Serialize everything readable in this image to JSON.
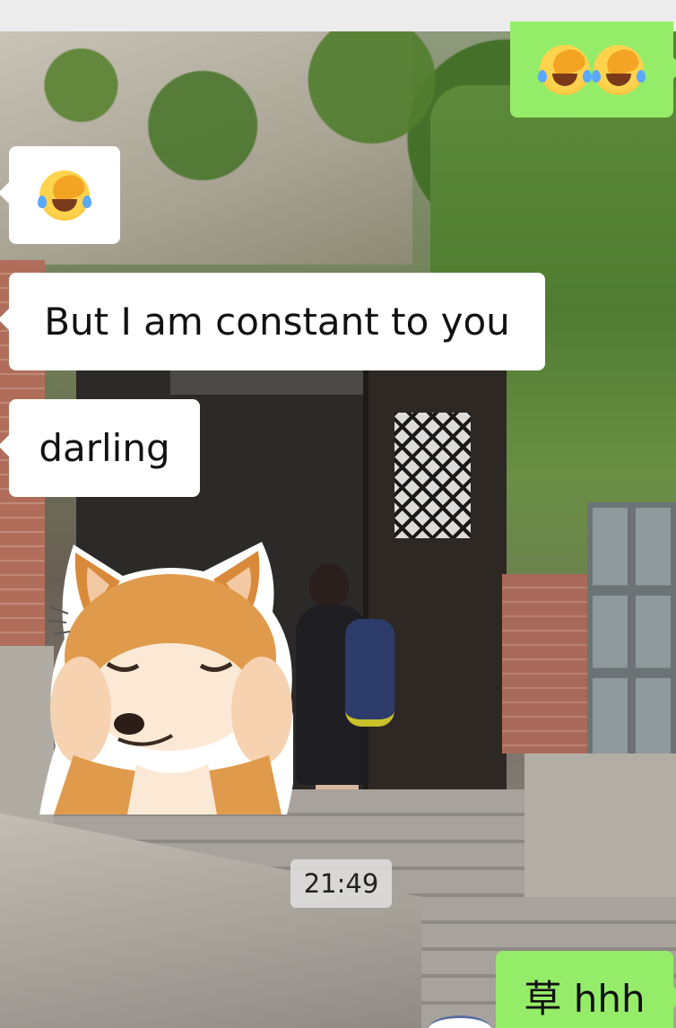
{
  "messages": [
    {
      "id": "m1",
      "direction": "outgoing",
      "emoji": [
        "face-with-hand-over-eyes-crying-laughing",
        "face-with-hand-over-eyes-crying-laughing"
      ]
    },
    {
      "id": "m2",
      "direction": "incoming",
      "emoji": [
        "face-with-hand-over-eyes-crying-laughing"
      ]
    },
    {
      "id": "m3",
      "direction": "incoming",
      "text": "But I am constant to you"
    },
    {
      "id": "m4",
      "direction": "incoming",
      "text": "darling"
    },
    {
      "id": "m5",
      "direction": "incoming",
      "sticker": "shiba-inu-cheek-squish"
    },
    {
      "id": "m6",
      "direction": "outgoing",
      "text": "草 hhh"
    }
  ],
  "timestamp": "21:49",
  "colors": {
    "incoming_bubble": "#ffffff",
    "outgoing_bubble": "#95ec69",
    "timestamp_bg": "#e1e1e1",
    "top_strip": "#ececec"
  },
  "wallpaper": "ivy-covered-building-entrance-photo"
}
